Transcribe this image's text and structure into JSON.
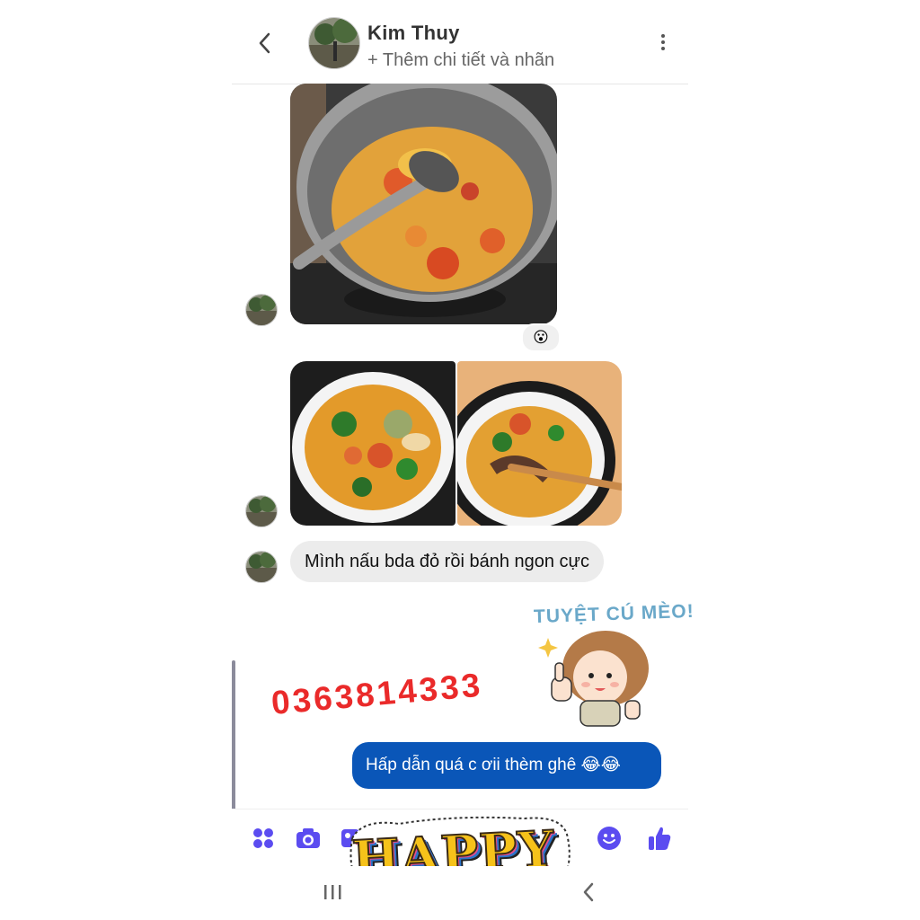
{
  "header": {
    "back_icon": "chevron-left-icon",
    "contact_name": "Kim Thuy",
    "subtitle": "+ Thêm chi tiết và nhãn",
    "menu_icon": "more-vertical-icon"
  },
  "messages": {
    "photo1_reaction": "😮",
    "incoming_text": "Mình nấu bda đỏ rồi bánh ngon cực",
    "outgoing_text": "Hấp dẫn quá c ơii thèm ghê 😂😂"
  },
  "overlay": {
    "sticker_caption": "TUYỆT CÚ MÈO!",
    "phone_number": "0363814333",
    "happy_sticker": "HAPPY"
  },
  "composer": {
    "icons": [
      "apps-icon",
      "camera-icon",
      "gallery-icon",
      "emoji-icon",
      "thumbs-up-icon"
    ]
  },
  "colors": {
    "accent": "#5b4cf0",
    "outgoing_bubble": "#0a56b8",
    "incoming_bubble": "#ececec",
    "phone_number": "#ea2a2a"
  }
}
